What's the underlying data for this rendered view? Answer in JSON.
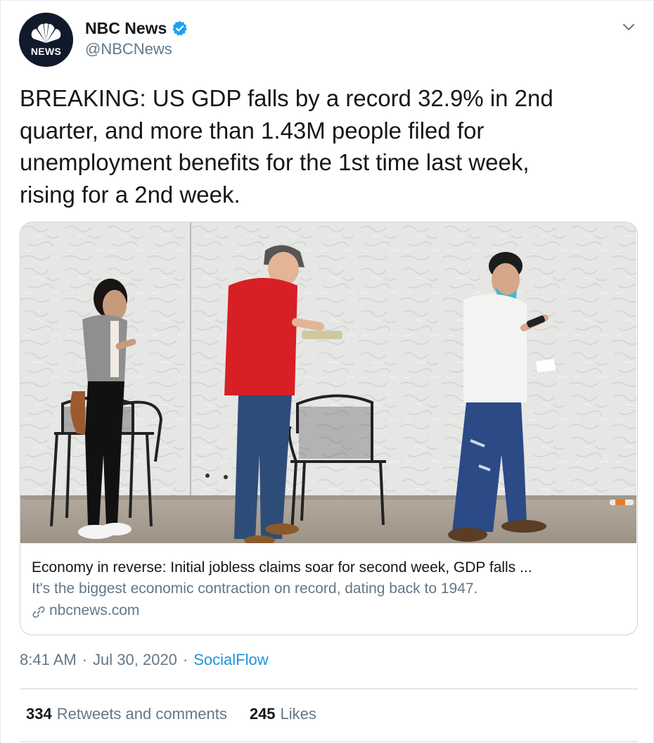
{
  "author": {
    "display_name": "NBC News",
    "handle": "@NBCNews",
    "avatar_text": "NEWS",
    "verified": true
  },
  "tweet": {
    "lines": [
      "BREAKING: US GDP falls by a record 32.9% in 2nd",
      "quarter, and more than 1.43M people filed for",
      "unemployment benefits for the 1st time last week,",
      "rising for a 2nd week."
    ]
  },
  "card": {
    "title": "Economy in reverse: Initial jobless claims soar for second week, GDP falls ...",
    "description": "It's the biggest economic contraction on record, dating back to 1947.",
    "domain": "nbcnews.com"
  },
  "meta": {
    "time": "8:41 AM",
    "separator": "·",
    "date": "Jul 30, 2020",
    "source": "SocialFlow"
  },
  "stats": {
    "retweets_count": "334",
    "retweets_label": "Retweets and comments",
    "likes_count": "245",
    "likes_label": "Likes"
  },
  "colors": {
    "text": "#14171a",
    "secondary": "#657786",
    "link": "#1b95e0",
    "verified": "#1da1f2",
    "border": "#ccd6dd"
  },
  "icons": {
    "verified": "verified-badge-icon",
    "caret": "chevron-down-icon",
    "link": "link-icon",
    "logo": "nbc-peacock-logo"
  }
}
